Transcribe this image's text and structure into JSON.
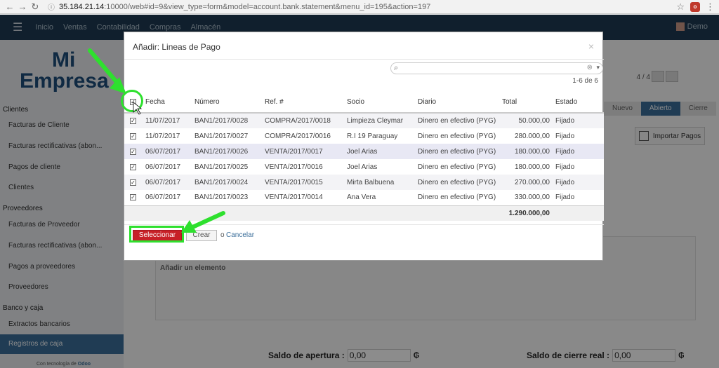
{
  "browser": {
    "url_host": "35.184.21.14",
    "url_path": ":10000/web#id=9&view_type=form&model=account.bank.statement&menu_id=195&action=197",
    "extension_badge": "o"
  },
  "topnav": {
    "items": [
      "Inicio",
      "Ventas",
      "Contabilidad",
      "Compras",
      "Almacén"
    ],
    "user": "Demo"
  },
  "sidebar": {
    "logo_line1": "Mi",
    "logo_line2": "Empresa",
    "sections": {
      "clientes": "Clientes",
      "proveedores": "Proveedores",
      "banco": "Banco y caja"
    },
    "items": {
      "facturas_cliente": "Facturas de Cliente",
      "rectificativas_cliente": "Facturas rectificativas (abon...",
      "pagos_cliente": "Pagos de cliente",
      "clientes": "Clientes",
      "facturas_proveedor": "Facturas de Proveedor",
      "rectificativas_proveedor": "Facturas rectificativas (abon...",
      "pagos_proveedores": "Pagos a proveedores",
      "proveedores": "Proveedores",
      "extractos": "Extractos bancarios",
      "registros": "Registros de caja"
    },
    "powered_prefix": "Con tecnología de",
    "powered_brand": "Odoo"
  },
  "main": {
    "pager": "4 / 4",
    "steps": [
      "Nuevo",
      "Abierto",
      "Cierre"
    ],
    "import_button": "Importar Pagos",
    "add_element": "Añadir un elemento",
    "saldo_apertura_label": "Saldo de apertura :",
    "saldo_apertura_value": "0,00",
    "saldo_cierre_label": "Saldo de cierre real :",
    "saldo_cierre_value": "0,00",
    "currency": "₲"
  },
  "modal": {
    "title": "Añadir: Lineas de Pago",
    "close": "×",
    "search_placeholder": "",
    "count": "1-6 de 6",
    "columns": [
      "Fecha",
      "Número",
      "Ref. #",
      "Socio",
      "Diario",
      "Total",
      "Estado"
    ],
    "rows": [
      {
        "fecha": "11/07/2017",
        "numero": "BAN1/2017/0028",
        "ref": "COMPRA/2017/0018",
        "socio": "Limpieza Cleymar",
        "diario": "Dinero en efectivo (PYG)",
        "total": "50.000,00",
        "estado": "Fijado"
      },
      {
        "fecha": "11/07/2017",
        "numero": "BAN1/2017/0027",
        "ref": "COMPRA/2017/0016",
        "socio": "R.I 19 Paraguay",
        "diario": "Dinero en efectivo (PYG)",
        "total": "280.000,00",
        "estado": "Fijado"
      },
      {
        "fecha": "06/07/2017",
        "numero": "BAN1/2017/0026",
        "ref": "VENTA/2017/0017",
        "socio": "Joel Arias",
        "diario": "Dinero en efectivo (PYG)",
        "total": "180.000,00",
        "estado": "Fijado"
      },
      {
        "fecha": "06/07/2017",
        "numero": "BAN1/2017/0025",
        "ref": "VENTA/2017/0016",
        "socio": "Joel Arias",
        "diario": "Dinero en efectivo (PYG)",
        "total": "180.000,00",
        "estado": "Fijado"
      },
      {
        "fecha": "06/07/2017",
        "numero": "BAN1/2017/0024",
        "ref": "VENTA/2017/0015",
        "socio": "Mirta Balbuena",
        "diario": "Dinero en efectivo (PYG)",
        "total": "270.000,00",
        "estado": "Fijado"
      },
      {
        "fecha": "06/07/2017",
        "numero": "BAN1/2017/0023",
        "ref": "VENTA/2017/0014",
        "socio": "Ana Vera",
        "diario": "Dinero en efectivo (PYG)",
        "total": "330.000,00",
        "estado": "Fijado"
      }
    ],
    "grand_total": "1.290.000,00",
    "select_button": "Seleccionar",
    "create_button": "Crear",
    "or_text": "o",
    "cancel_link": "Cancelar"
  },
  "annotation_color": "#2ee02e"
}
